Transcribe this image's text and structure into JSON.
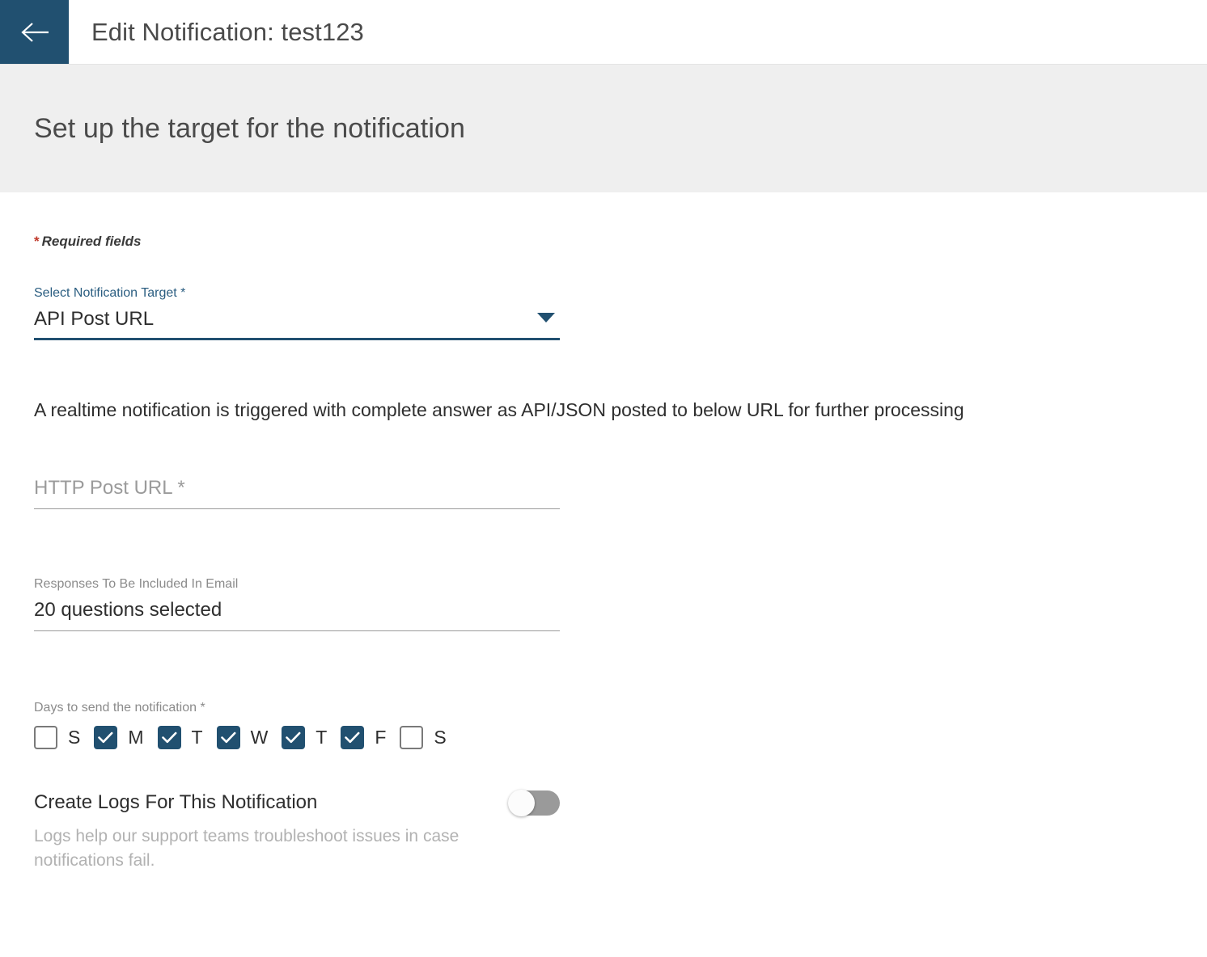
{
  "header": {
    "back_icon": "arrow-left-icon",
    "title": "Edit Notification: test123",
    "back_color": "#215070"
  },
  "banner": {
    "title": "Set up the target for the notification",
    "background": "#efefef"
  },
  "form": {
    "required_note": {
      "asterisk": "*",
      "text": "Required fields",
      "asterisk_color": "#c0392b"
    },
    "notification_target": {
      "label": "Select Notification Target *",
      "label_color": "#2a5d80",
      "value": "API Post URL",
      "caret_icon": "chevron-down-icon",
      "options": [
        "API Post URL"
      ]
    },
    "description": "A realtime notification is triggered with complete answer as API/JSON posted to below URL for further processing",
    "http_post_url": {
      "placeholder": "HTTP Post URL *",
      "value": ""
    },
    "responses_included": {
      "label": "Responses To Be Included In Email",
      "value": "20 questions selected"
    },
    "days": {
      "label": "Days to send the notification *",
      "items": [
        {
          "letter": "S",
          "name": "sunday",
          "checked": false
        },
        {
          "letter": "M",
          "name": "monday",
          "checked": true
        },
        {
          "letter": "T",
          "name": "tuesday",
          "checked": true
        },
        {
          "letter": "W",
          "name": "wednesday",
          "checked": true
        },
        {
          "letter": "T",
          "name": "thursday",
          "checked": true
        },
        {
          "letter": "F",
          "name": "friday",
          "checked": true
        },
        {
          "letter": "S",
          "name": "saturday",
          "checked": false
        }
      ],
      "checked_color": "#215070"
    },
    "create_logs": {
      "title": "Create Logs For This Notification",
      "enabled": false,
      "help": "Logs help our support teams troubleshoot issues in case notifications fail."
    }
  }
}
